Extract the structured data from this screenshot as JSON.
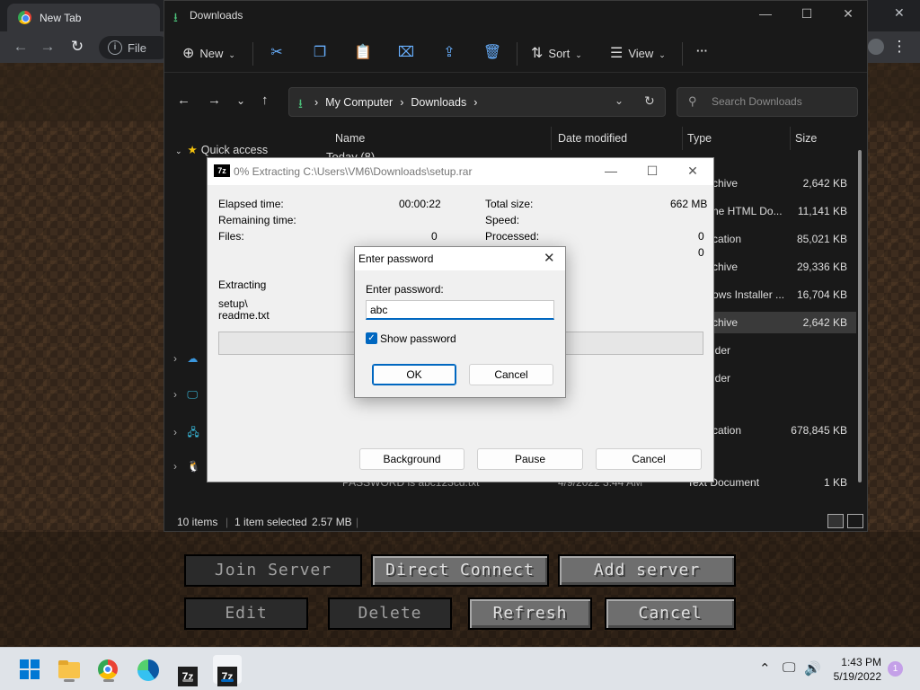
{
  "chrome": {
    "tab_title": "New Tab",
    "omnibox_text": "File"
  },
  "explorer": {
    "title": "Downloads",
    "cmd": {
      "new_label": "New",
      "sort_label": "Sort",
      "view_label": "View",
      "more_label": "···"
    },
    "breadcrumb": [
      "My Computer",
      "Downloads"
    ],
    "search_placeholder": "Search Downloads",
    "nav": {
      "quick_access": "Quick access"
    },
    "columns": {
      "name": "Name",
      "date": "Date modified",
      "type": "Type",
      "size": "Size"
    },
    "group_header": "Today (8)",
    "rows": [
      {
        "type": "chive",
        "size": "2,642 KB"
      },
      {
        "type": "ne HTML Do...",
        "size": "11,141 KB"
      },
      {
        "type": "cation",
        "size": "85,021 KB"
      },
      {
        "type": "chive",
        "size": "29,336 KB"
      },
      {
        "type": "ows Installer ...",
        "size": "16,704 KB"
      },
      {
        "type": "chive",
        "size": "2,642 KB"
      },
      {
        "type": "lder",
        "size": ""
      },
      {
        "type": "lder",
        "size": ""
      },
      {
        "type": "cation",
        "size": "678,845 KB"
      }
    ],
    "last_row": {
      "name": "PASSWORD is abc123cd.txt",
      "date": "4/9/2022 3:44 AM",
      "type": "Text Document",
      "size": "1 KB"
    },
    "status": {
      "items": "10 items",
      "selected": "1 item selected",
      "size": "2.57 MB"
    }
  },
  "zip": {
    "title": "0% Extracting C:\\Users\\VM6\\Downloads\\setup.rar",
    "elapsed_label": "Elapsed time:",
    "elapsed_value": "00:00:22",
    "remaining_label": "Remaining time:",
    "files_label": "Files:",
    "files_value": "0",
    "total_label": "Total size:",
    "total_value": "662 MB",
    "speed_label": "Speed:",
    "processed_label": "Processed:",
    "processed_value": "0",
    "fourth_value": "0",
    "extracting_label": "Extracting",
    "path_line1": "setup\\",
    "path_line2": "readme.txt",
    "progress_percent": 0,
    "background_btn": "Background",
    "pause_btn": "Pause",
    "cancel_btn": "Cancel"
  },
  "password_dialog": {
    "title": "Enter password",
    "label": "Enter password:",
    "value": "abc",
    "show_password_label": "Show password",
    "show_password_checked": true,
    "ok": "OK",
    "cancel": "Cancel"
  },
  "minecraft": {
    "join_server": "Join Server",
    "direct_connect": "Direct Connect",
    "add_server": "Add server",
    "edit": "Edit",
    "delete": "Delete",
    "refresh": "Refresh",
    "cancel": "Cancel"
  },
  "taskbar": {
    "time": "1:43 PM",
    "date": "5/19/2022",
    "notification_count": "1"
  }
}
